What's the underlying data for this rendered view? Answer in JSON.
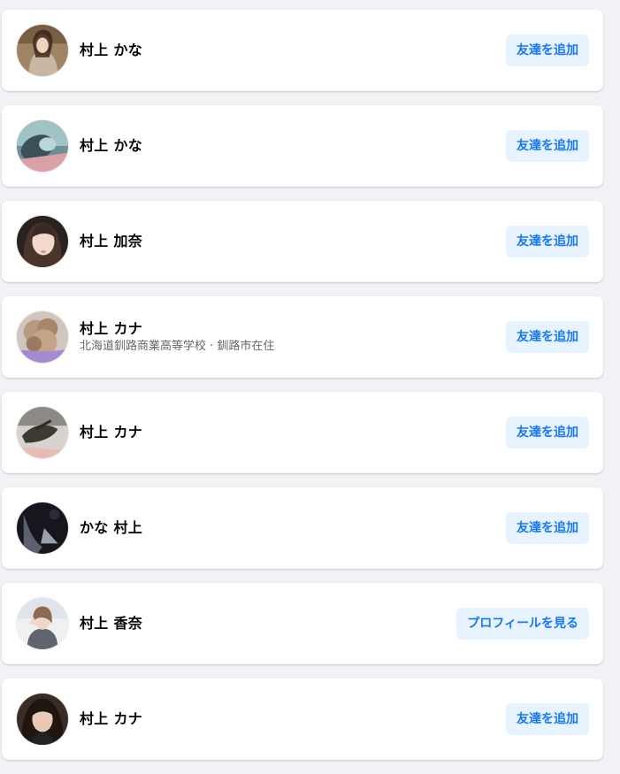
{
  "colors": {
    "page_background": "#f0f2f5",
    "card_background": "#ffffff",
    "name_text": "#050505",
    "meta_text": "#65676b",
    "button_background": "#e7f3ff",
    "button_text": "#1877f2"
  },
  "people": [
    {
      "name": "村上 かな",
      "meta": "",
      "action": "友達を追加",
      "avatar": "portrait-avatar"
    },
    {
      "name": "村上 かな",
      "meta": "",
      "action": "友達を追加",
      "avatar": "portrait-avatar"
    },
    {
      "name": "村上 加奈",
      "meta": "",
      "action": "友達を追加",
      "avatar": "portrait-avatar"
    },
    {
      "name": "村上 カナ",
      "meta": "北海道釧路商業高等学校 · 釧路市在住",
      "action": "友達を追加",
      "avatar": "dog-avatar"
    },
    {
      "name": "村上 カナ",
      "meta": "",
      "action": "友達を追加",
      "avatar": "beetle-avatar"
    },
    {
      "name": "かな 村上",
      "meta": "",
      "action": "友達を追加",
      "avatar": "dark-photo-avatar"
    },
    {
      "name": "村上 香奈",
      "meta": "",
      "action": "プロフィールを見る",
      "avatar": "portrait-avatar"
    },
    {
      "name": "村上 カナ",
      "meta": "",
      "action": "友達を追加",
      "avatar": "portrait-avatar"
    }
  ]
}
